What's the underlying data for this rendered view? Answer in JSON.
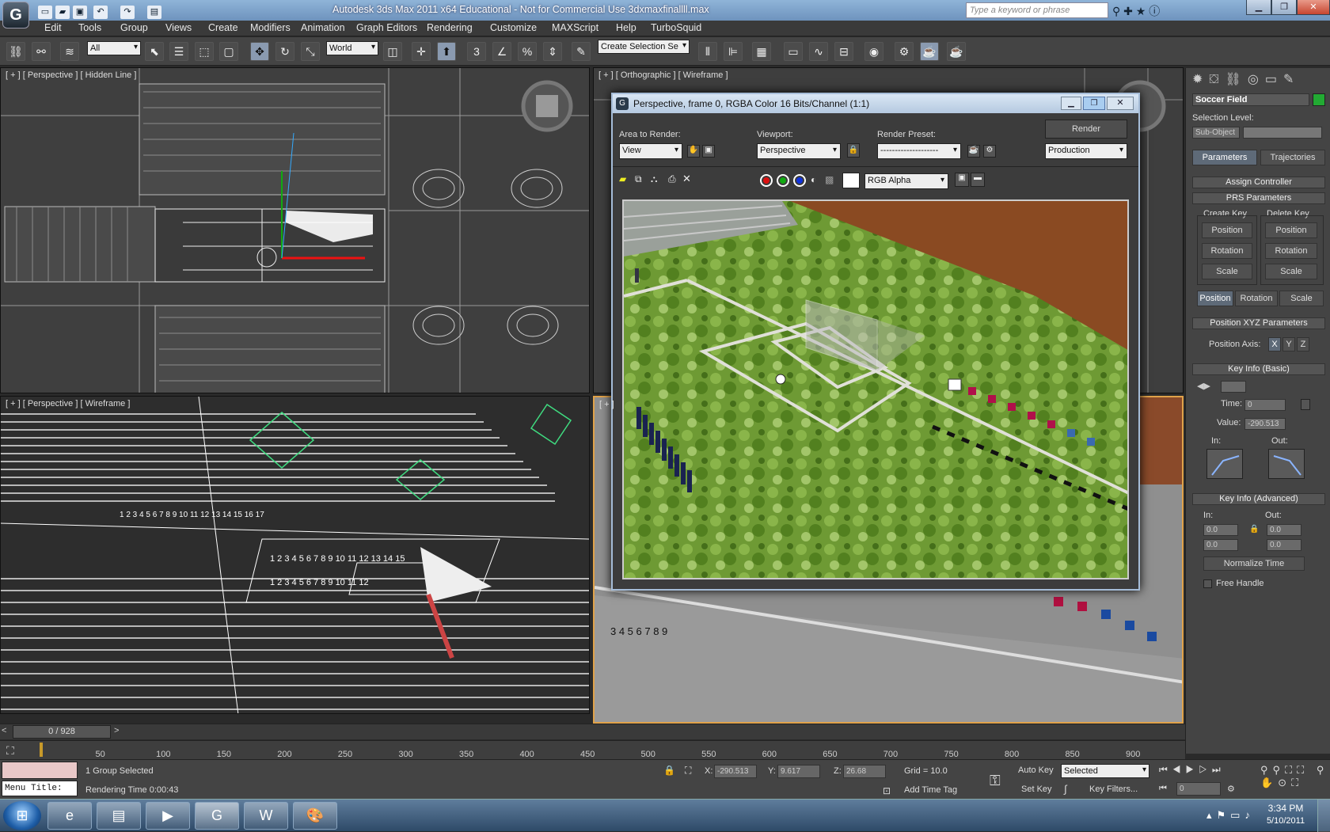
{
  "title_bar": {
    "logo": "G",
    "title": "Autodesk 3ds Max  2011 x64   Educational - Not for Commercial Use   3dxmaxfinallll.max",
    "search_placeholder": "Type a keyword or phrase"
  },
  "menu": [
    "Edit",
    "Tools",
    "Group",
    "Views",
    "Create",
    "Modifiers",
    "Animation",
    "Graph Editors",
    "Rendering",
    "Customize",
    "MAXScript",
    "Help",
    "TurboSquid"
  ],
  "toolbar": {
    "selection_filter": "All",
    "reference_coord": "World",
    "named_selection": "Create Selection Se",
    "snap_label": "3"
  },
  "viewports": {
    "top_left": "[ + ] [ Perspective ] [ Hidden Line ]",
    "top_right": "[ + ] [ Orthographic ] [ Wireframe ]",
    "bottom_left": "[ + ] [ Perspective ] [ Wireframe ]",
    "bottom_right": "[ + ]"
  },
  "render_window": {
    "title": "Perspective, frame 0, RGBA Color 16 Bits/Channel (1:1)",
    "area_label": "Area to Render:",
    "area_value": "View",
    "viewport_label": "Viewport:",
    "viewport_value": "Perspective",
    "preset_label": "Render Preset:",
    "preset_value": "--------------------",
    "render_button": "Render",
    "production_value": "Production",
    "channel_value": "RGB Alpha",
    "swatch_colors": [
      "#dd1111",
      "#11aa11",
      "#1133dd"
    ]
  },
  "command_panel": {
    "object_name": "Soccer Field",
    "object_color": "#22aa33",
    "selection_level_label": "Selection Level:",
    "sub_object": "Sub-Object",
    "tabs": [
      "Parameters",
      "Trajectories"
    ],
    "assign_controller": "Assign Controller",
    "prs_parameters": "PRS Parameters",
    "create_key": "Create Key",
    "delete_key": "Delete Key",
    "key_buttons": [
      "Position",
      "Rotation",
      "Scale"
    ],
    "bottom_tabs": [
      "Position",
      "Rotation",
      "Scale"
    ],
    "position_xyz": "Position XYZ Parameters",
    "position_axis_label": "Position Axis:",
    "axes": [
      "X",
      "Y",
      "Z"
    ],
    "key_info_basic": "Key Info (Basic)",
    "time_label": "Time:",
    "time_value": "0",
    "value_label": "Value:",
    "value_value": "-290.513",
    "in_label": "In:",
    "out_label": "Out:",
    "key_info_advanced": "Key Info (Advanced)",
    "adv_in_label": "In:",
    "adv_out_label": "Out:",
    "adv_values": [
      "0.0",
      "0.0",
      "0.0",
      "0.0"
    ],
    "normalize_time": "Normalize Time",
    "free_handle": "Free Handle"
  },
  "timeline": {
    "frame_counter": "0 / 928",
    "ticks": [
      "0",
      "50",
      "100",
      "150",
      "200",
      "250",
      "300",
      "350",
      "400",
      "450",
      "500",
      "550",
      "600",
      "650",
      "700",
      "750",
      "800",
      "850",
      "900"
    ]
  },
  "status": {
    "menu_title": "Menu Title:",
    "selection": "1 Group Selected",
    "rendering_time": "Rendering Time  0:00:43",
    "x_label": "X:",
    "x_value": "-290.513",
    "y_label": "Y:",
    "y_value": "9.617",
    "z_label": "Z:",
    "z_value": "26.68",
    "grid": "Grid = 10.0",
    "auto_key": "Auto Key",
    "key_mode": "Selected",
    "set_key": "Set Key",
    "key_filters": "Key Filters...",
    "add_time_tag": "Add Time Tag",
    "frame_field": "0"
  },
  "taskbar": {
    "time": "3:34 PM",
    "date": "5/10/2011"
  }
}
